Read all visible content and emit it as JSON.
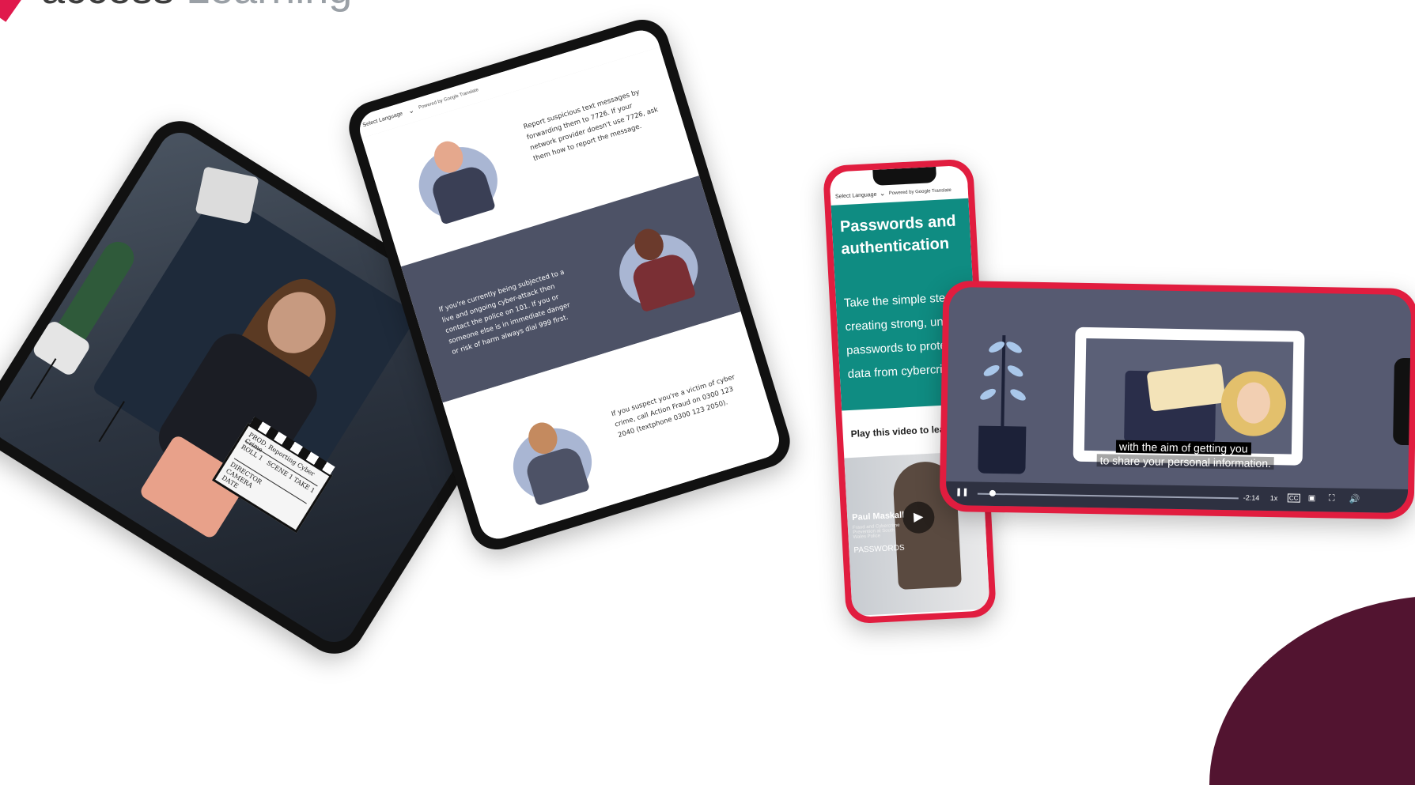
{
  "brand": {
    "name_bold": "access",
    "name_light": " Learning"
  },
  "tablet1": {
    "clapper": {
      "line1": "PROD. Reporting Cyber Crime",
      "roll": "ROLL 1",
      "scene": "SCENE 1",
      "take": "TAKE 1",
      "director": "DIRECTOR",
      "camera": "CAMERA",
      "date": "DATE"
    }
  },
  "tablet2": {
    "lang_label": "Select Language",
    "powered": "Powered by Google Translate",
    "section1": "Report suspicious text messages by forwarding them to 7726. If your network provider doesn't use 7726, ask them how to report the message.",
    "section2": "If you're currently being subjected to a live and ongoing cyber-attack then contact the police on 101. If you or someone else is in immediate danger or risk of harm always dial 999 first.",
    "section3": "If you suspect you're a victim of cyber crime, call Action Fraud on 0300 123 2040 (textphone 0300 123 2050)."
  },
  "phone1": {
    "lang_label": "Select Language",
    "powered": "Powered by Google Translate",
    "title": "Passwords and authentication",
    "body": "Take the simple step of creating strong, unique passwords to protect your data from cybercriminals",
    "play_label": "Play this video to learn more",
    "video": {
      "name": "Paul Maskall",
      "role": "Fraud and Cybercrime Prevention at South Wales Police",
      "category": "PASSWORDS"
    }
  },
  "phone2": {
    "caption_line1": "with the aim of getting you",
    "caption_line2": "to share your personal information.",
    "time_remaining": "-2:14",
    "speed": "1x",
    "cc": "CC",
    "progress": 0.04
  },
  "colors": {
    "brand_red": "#e0194c",
    "teal": "#0f8c82",
    "slate": "#4d5266",
    "plum": "#521430"
  }
}
